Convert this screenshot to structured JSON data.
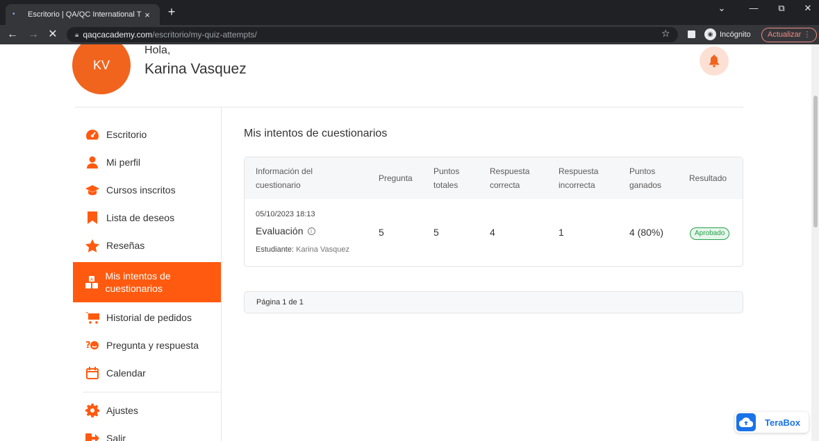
{
  "browser": {
    "tab_title": "Escritorio | QA/QC International T",
    "tab_close": "×",
    "new_tab": "+",
    "url_host": "qaqcacademy.com",
    "url_path": "/escritorio/my-quiz-attempts/",
    "incognito_label": "Incógnito",
    "update_label": "Actualizar",
    "update_menu": "⋮",
    "back": "←",
    "forward": "→",
    "stop": "✕",
    "star": "☆",
    "minimize": "—",
    "restore": "⧉",
    "close": "✕",
    "tab_search": "⌄"
  },
  "user": {
    "initials": "KV",
    "greeting": "Hola,",
    "name": "Karina Vasquez"
  },
  "sidebar": {
    "items": [
      {
        "label": "Escritorio",
        "icon": "dashboard-icon"
      },
      {
        "label": "Mi perfil",
        "icon": "user-icon"
      },
      {
        "label": "Cursos inscritos",
        "icon": "graduation-cap-icon"
      },
      {
        "label": "Lista de deseos",
        "icon": "bookmark-icon"
      },
      {
        "label": "Reseñas",
        "icon": "star-icon"
      },
      {
        "label": "Mis intentos de cuestionarios",
        "icon": "quiz-icon",
        "active": true
      },
      {
        "label": "Historial de pedidos",
        "icon": "cart-icon"
      },
      {
        "label": "Pregunta y respuesta",
        "icon": "qa-icon"
      },
      {
        "label": "Calendar",
        "icon": "calendar-icon"
      },
      {
        "label": "Ajustes",
        "icon": "gear-icon"
      },
      {
        "label": "Salir",
        "icon": "logout-icon"
      }
    ]
  },
  "main": {
    "title": "Mis intentos de cuestionarios",
    "table": {
      "headers": [
        "Información del cuestionario",
        "Pregunta",
        "Puntos totales",
        "Respuesta correcta",
        "Respuesta incorrecta",
        "Puntos ganados",
        "Resultado"
      ],
      "row": {
        "date": "05/10/2023 18:13",
        "quiz": "Evaluación",
        "info_glyph": "i",
        "student_label": "Estudiante:",
        "student_name": "Karina Vasquez",
        "questions": "5",
        "total_points": "5",
        "correct": "4",
        "incorrect": "1",
        "earned": "4 (80%)",
        "result": "Aprobado"
      }
    },
    "pagination": "Página 1 de 1"
  },
  "widget": {
    "label": "TeraBox"
  },
  "colors": {
    "accent": "#ff5a0f",
    "avatar": "#f1641e",
    "success": "#24a148"
  }
}
